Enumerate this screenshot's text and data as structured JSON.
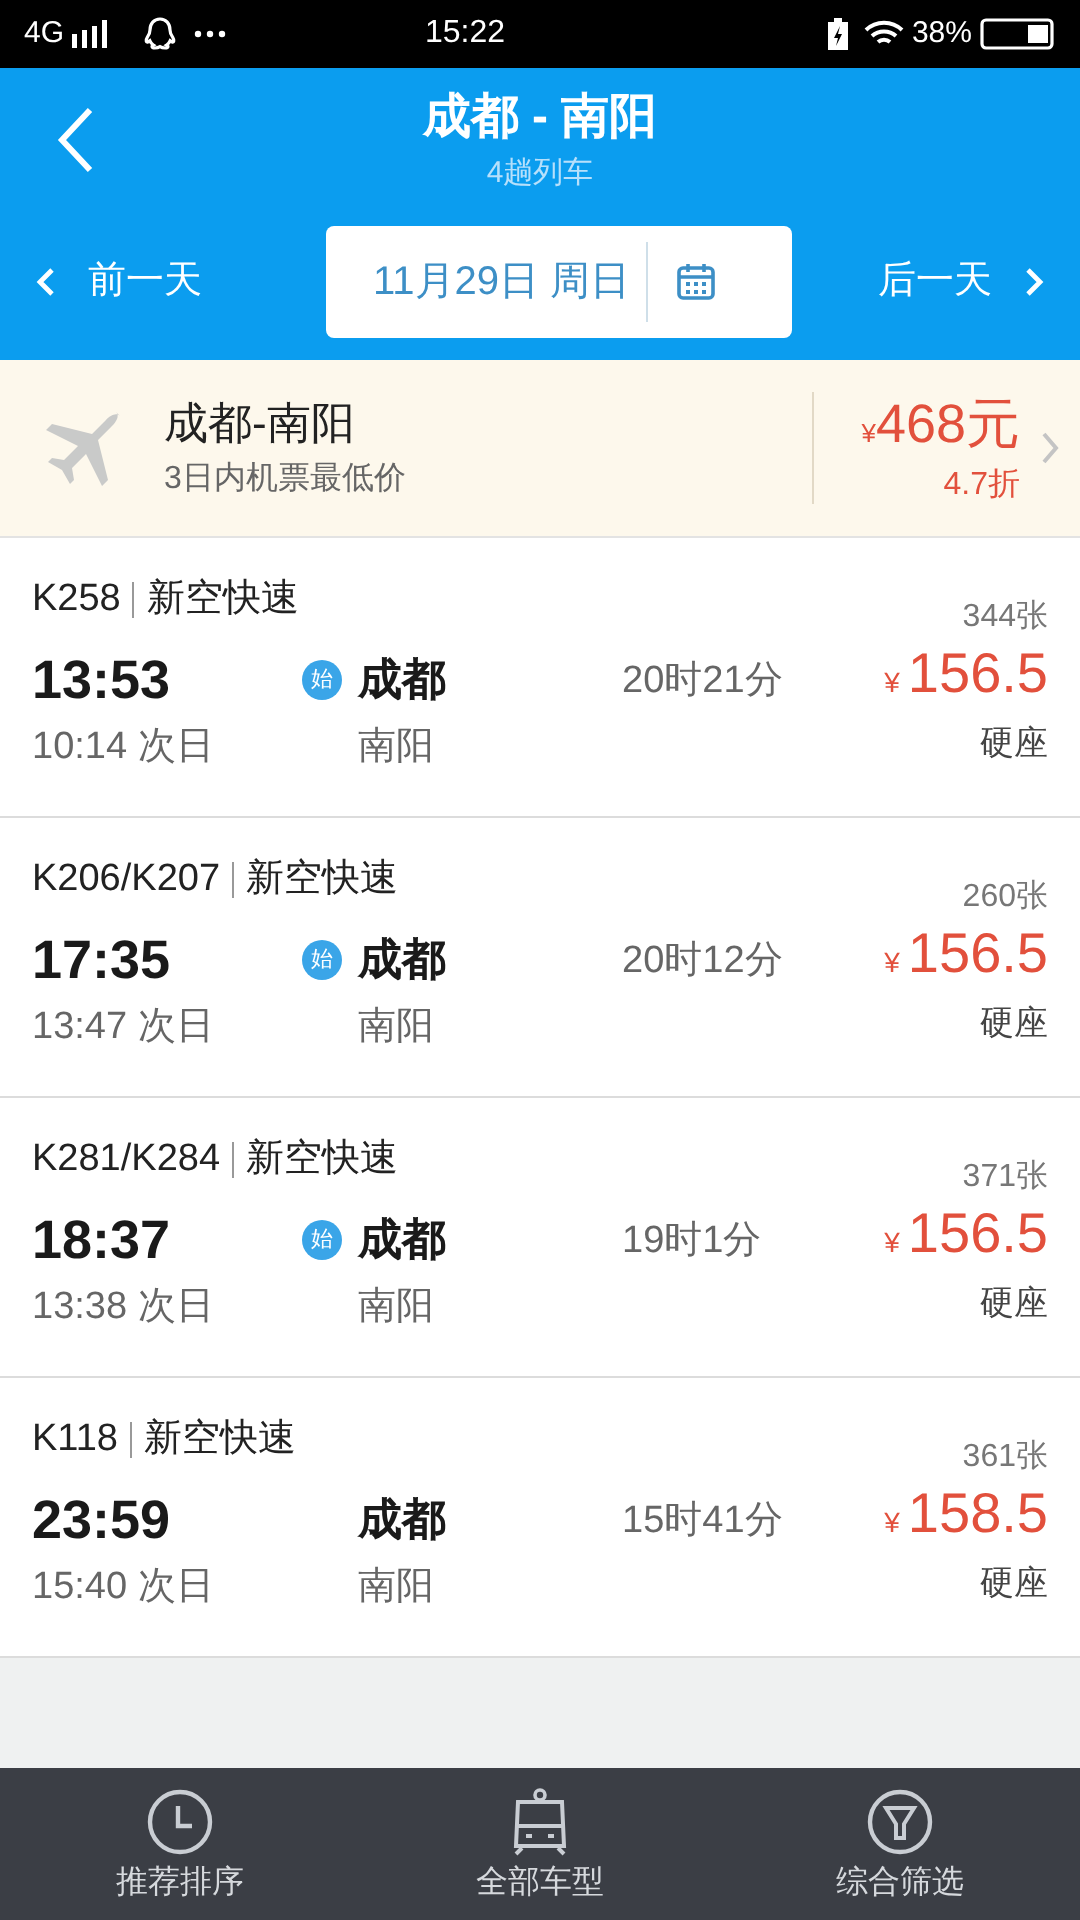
{
  "status_bar": {
    "network": "4G",
    "time": "15:22",
    "battery": "38%"
  },
  "header": {
    "title": "成都 - 南阳",
    "subtitle": "4趟列车"
  },
  "date_bar": {
    "prev": "前一天",
    "date": "11月29日 周日",
    "next": "后一天"
  },
  "flight_banner": {
    "route": "成都-南阳",
    "note": "3日内机票最低价",
    "currency": "¥",
    "price": "468元",
    "discount": "4.7折"
  },
  "trains": [
    {
      "number": "K258",
      "type": "新空快速",
      "depart": "13:53",
      "arrive": "10:14 次日",
      "from": "成都",
      "to": "南阳",
      "badge": "始",
      "duration": "20时21分",
      "tickets": "344张",
      "currency": "¥",
      "price": "156.5",
      "seat": "硬座"
    },
    {
      "number": "K206/K207",
      "type": "新空快速",
      "depart": "17:35",
      "arrive": "13:47 次日",
      "from": "成都",
      "to": "南阳",
      "badge": "始",
      "duration": "20时12分",
      "tickets": "260张",
      "currency": "¥",
      "price": "156.5",
      "seat": "硬座"
    },
    {
      "number": "K281/K284",
      "type": "新空快速",
      "depart": "18:37",
      "arrive": "13:38 次日",
      "from": "成都",
      "to": "南阳",
      "badge": "始",
      "duration": "19时1分",
      "tickets": "371张",
      "currency": "¥",
      "price": "156.5",
      "seat": "硬座"
    },
    {
      "number": "K118",
      "type": "新空快速",
      "depart": "23:59",
      "arrive": "15:40 次日",
      "from": "成都",
      "to": "南阳",
      "duration": "15时41分",
      "tickets": "361张",
      "currency": "¥",
      "price": "158.5",
      "seat": "硬座"
    }
  ],
  "bottom_tabs": [
    {
      "label": "推荐排序",
      "kind": "clock"
    },
    {
      "label": "全部车型",
      "kind": "train"
    },
    {
      "label": "综合筛选",
      "kind": "filter"
    }
  ]
}
